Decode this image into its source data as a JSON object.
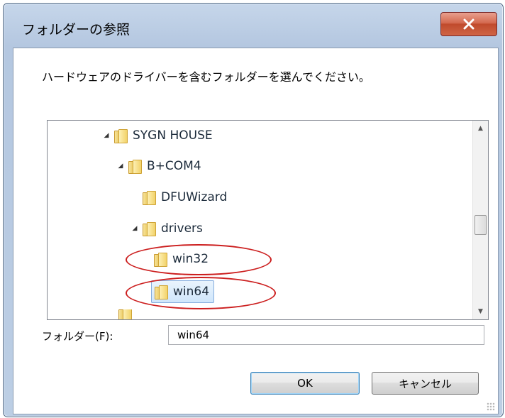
{
  "window": {
    "title": "フォルダーの参照",
    "close_label": "X"
  },
  "instruction": "ハードウェアのドライバーを含むフォルダーを選んでください。",
  "tree": {
    "items": [
      {
        "label": "SYGN HOUSE",
        "expanded": true,
        "level": 0
      },
      {
        "label": "B+COM4",
        "expanded": true,
        "level": 1
      },
      {
        "label": "DFUWizard",
        "expanded": false,
        "level": 2
      },
      {
        "label": "drivers",
        "expanded": true,
        "level": 2
      },
      {
        "label": "win32",
        "expanded": false,
        "level": 3,
        "circled": true
      },
      {
        "label": "win64",
        "expanded": false,
        "level": 3,
        "circled": true,
        "selected": true
      }
    ]
  },
  "folder_field": {
    "label": "フォルダー(F):",
    "value": "win64"
  },
  "buttons": {
    "ok": "OK",
    "cancel": "キャンセル"
  },
  "colors": {
    "annotation_red": "#cc1f1f",
    "selection_border": "#84acdd",
    "ok_focus_border": "#3c7fb1"
  }
}
